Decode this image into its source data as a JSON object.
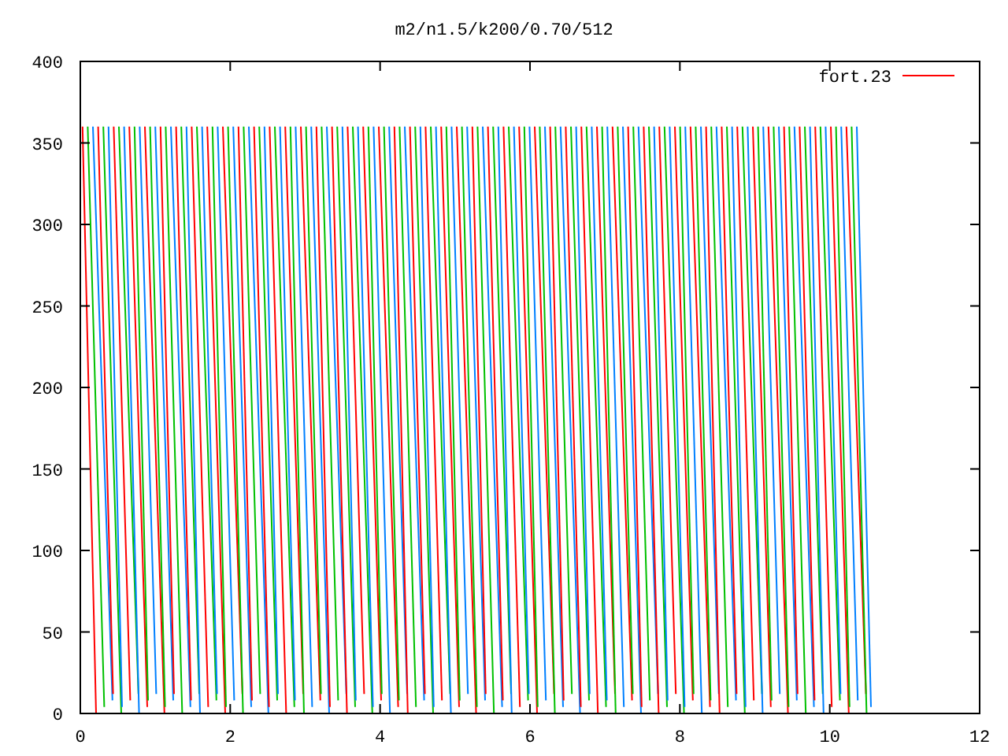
{
  "plot": {
    "title": "m2/n1.5/k200/0.70/512",
    "legend": {
      "label": "fort.23",
      "color": "#ff0000"
    },
    "yticks": [
      "400",
      "350",
      "300",
      "250",
      "200",
      "150",
      "100",
      "50",
      "0"
    ],
    "xticks": [
      "0",
      "2",
      "4",
      "6",
      "8",
      "10",
      "12"
    ]
  }
}
